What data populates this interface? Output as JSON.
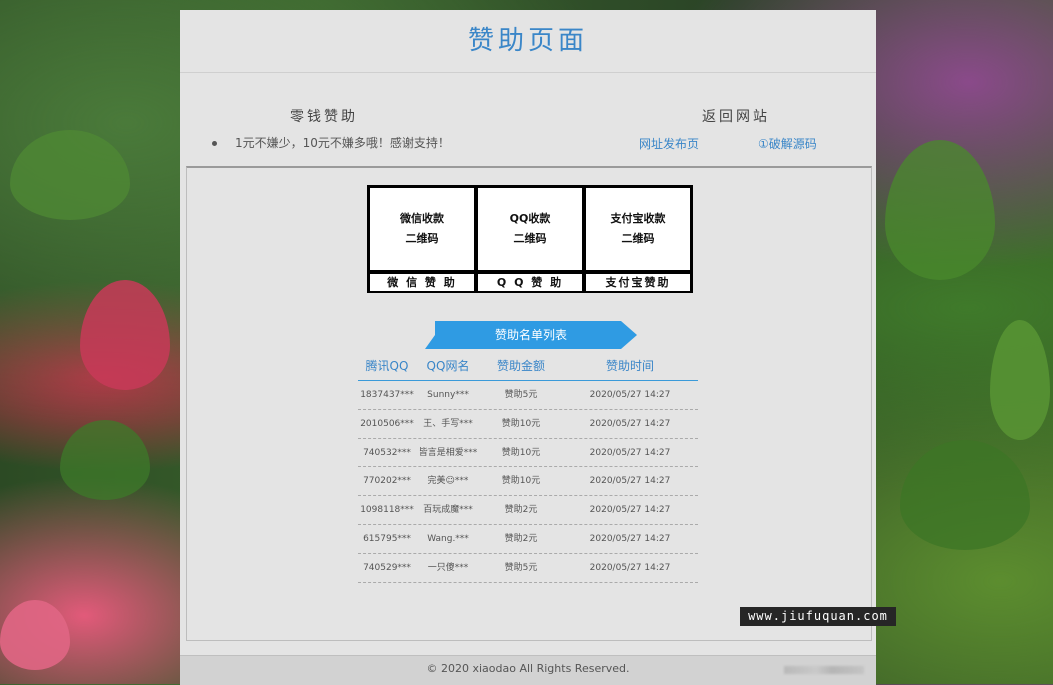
{
  "page": {
    "title": "赞助页面"
  },
  "left_section": {
    "heading": "零钱赞助",
    "note": "1元不嫌少，10元不嫌多哦！感谢支持！"
  },
  "right_section": {
    "heading": "返回网站",
    "links": [
      "网址发布页",
      "①破解源码"
    ]
  },
  "qr_codes": [
    {
      "line1": "微信收款",
      "line2": "二维码",
      "caption": "微 信 赞 助"
    },
    {
      "line1": "QQ收款",
      "line2": "二维码",
      "caption": "Q Q 赞 助"
    },
    {
      "line1": "支付宝收款",
      "line2": "二维码",
      "caption": "支付宝赞助"
    }
  ],
  "sponsor_list": {
    "ribbon_title": "赞助名单列表",
    "ribbon_color": "#2f9be3",
    "headers": [
      "腾讯QQ",
      "QQ网名",
      "赞助金额",
      "赞助时间"
    ],
    "rows": [
      [
        "1837437***",
        "Sunny***",
        "赞助5元",
        "2020/05/27 14:27"
      ],
      [
        "2010506***",
        "王、手写***",
        "赞助10元",
        "2020/05/27 14:27"
      ],
      [
        "740532***",
        "皆言是相爱***",
        "赞助10元",
        "2020/05/27 14:27"
      ],
      [
        "770202***",
        "完美☺***",
        "赞助10元",
        "2020/05/27 14:27"
      ],
      [
        "1098118***",
        "百玩成魔***",
        "赞助2元",
        "2020/05/27 14:27"
      ],
      [
        "615795***",
        "Wang.***",
        "赞助2元",
        "2020/05/27 14:27"
      ],
      [
        "740529***",
        "一只傻***",
        "赞助5元",
        "2020/05/27 14:27"
      ]
    ]
  },
  "footer": {
    "copyright": "© 2020 xiaodao All Rights Reserved."
  },
  "watermark": "www.jiufuquan.com",
  "colors": {
    "accent": "#3a86c8",
    "panel": "#e4e4e4"
  }
}
